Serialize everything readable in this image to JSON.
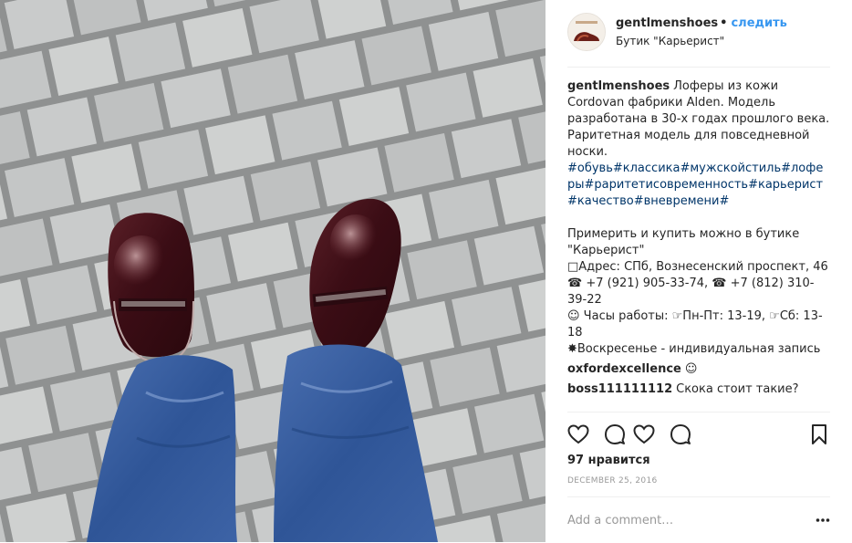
{
  "post": {
    "username": "gentlmenshoes",
    "separator": "•",
    "follow_label": "следить",
    "location": "Бутик \"Карьерист\""
  },
  "caption": {
    "username": "gentlmenshoes",
    "text": "Лоферы из кожи Cordovan фабрики Alden. Модель разработана в 30-х годах прошлого века. Раритетная модель для повседневной носки.",
    "hashtags": "#обувь#классика#мужскойстиль#лоферы#раритетисовременность#карьерист#качество#вневремени#",
    "extra": "Примерить и купить можно в бутике \"Карьерист\"\n□Адрес: СПб, Вознесенский проспект, 46\n☎ +7 (921) 905-33-74, ☎ +7 (812) 310-39-22\n☺ Часы работы: ☞Пн-Пт: 13-19, ☞Сб: 13-18\n✸Воскресенье - индивидуальная запись"
  },
  "comments": [
    {
      "username": "oxfordexcellence",
      "text": "☺"
    },
    {
      "username": "boss111111112",
      "text": "Скока стоит такие?"
    }
  ],
  "actions": {
    "icons": [
      "heart-icon",
      "comment-icon",
      "heart-icon",
      "comment-icon",
      "bookmark-icon"
    ]
  },
  "likes": "97 нравится",
  "date": "DECEMBER 25, 2016",
  "add_comment": {
    "placeholder": "Add a comment…"
  },
  "colors": {
    "link": "#3897f0",
    "hashtag": "#003569",
    "text": "#262626",
    "muted": "#999999",
    "divider": "#efefef"
  }
}
